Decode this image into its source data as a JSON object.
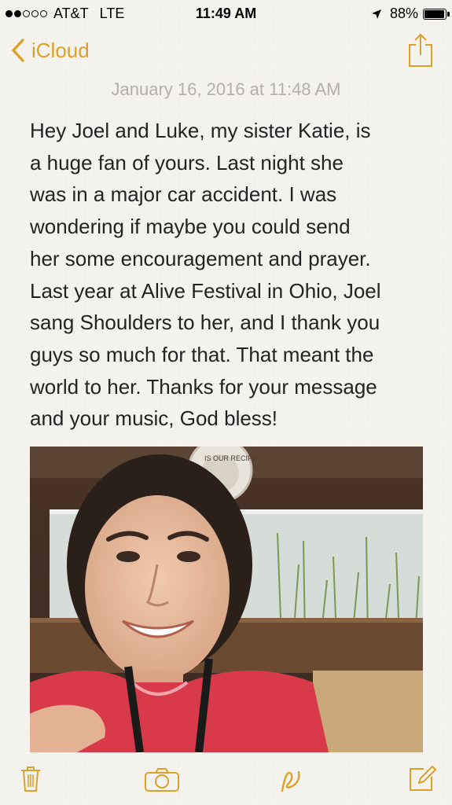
{
  "status_bar": {
    "carrier": "AT&T",
    "network": "LTE",
    "time": "11:49 AM",
    "battery": "88%",
    "battery_level": 0.88,
    "signal_bars_filled": 2,
    "signal_bars_total": 5,
    "icons": [
      "signal-dots-icon",
      "location-arrow-icon",
      "battery-icon"
    ]
  },
  "nav": {
    "back_label": "iCloud",
    "back_icon": "chevron-left-icon",
    "share_icon": "share-icon"
  },
  "note": {
    "date": "January 16, 2016 at 11:48 AM",
    "lines": [
      "Hey Joel and Luke, my sister Katie, is",
      "a huge fan of yours. Last night she",
      "was in a major car accident. I was",
      "wondering if maybe you could send",
      "her some encouragement and prayer.",
      "Last year at Alive Festival in Ohio, Joel",
      "sang Shoulders to her, and I thank you",
      "guys so much for that. That meant the",
      "world to her. Thanks for your message",
      "and your music, God bless!"
    ],
    "photo_sign_text": "IS OUR RECIPE"
  },
  "toolbar": {
    "items": [
      "trash-icon",
      "camera-icon",
      "sketch-icon",
      "compose-icon"
    ]
  },
  "colors": {
    "accent": "#dca126",
    "paper": "#f6f4ef",
    "date_gray": "#b3b0aa",
    "text": "#232323"
  }
}
